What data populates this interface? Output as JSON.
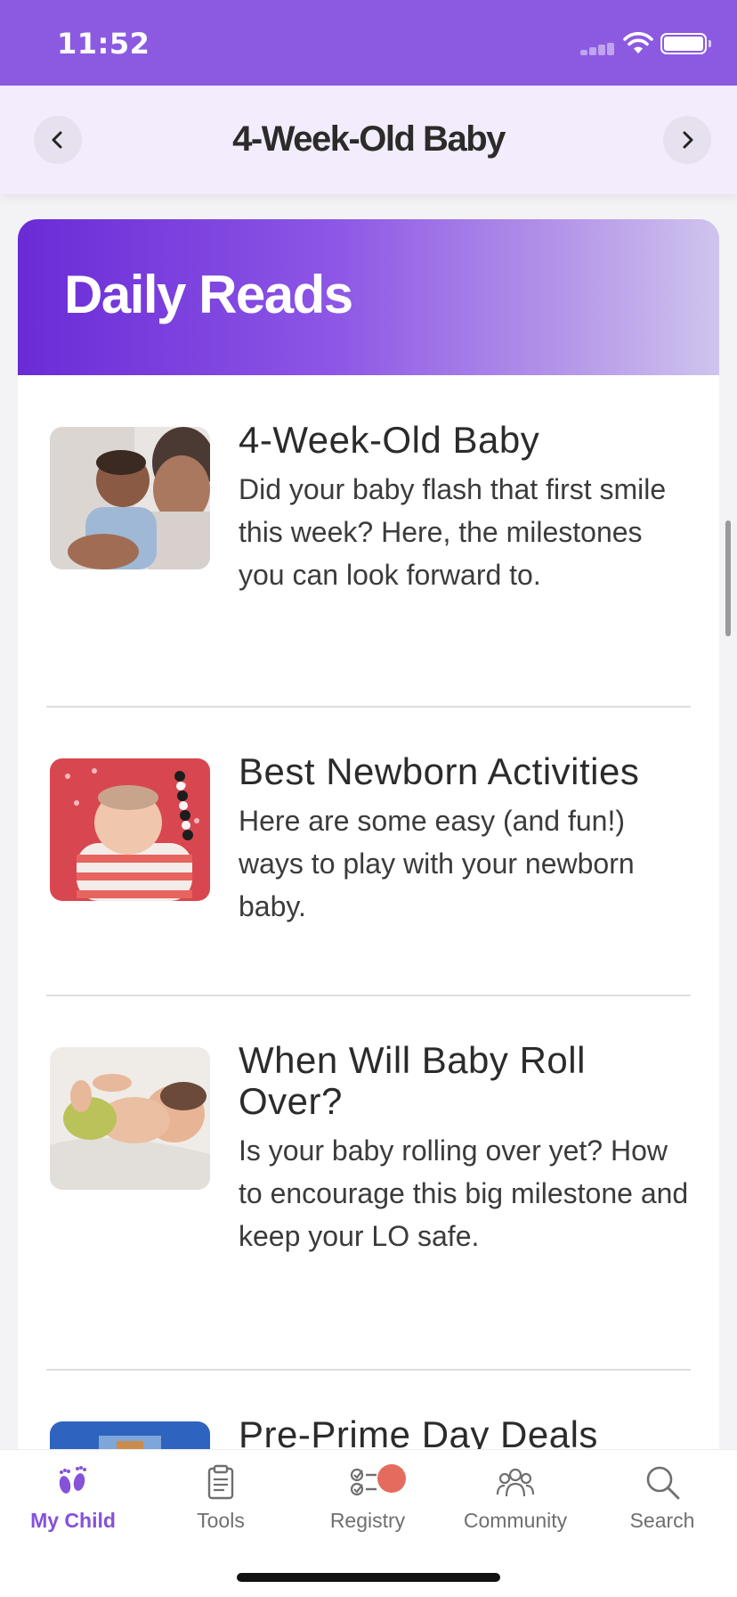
{
  "status_bar": {
    "time": "11:52"
  },
  "nav": {
    "title": "4-Week-Old Baby"
  },
  "card": {
    "header_title": "Daily Reads"
  },
  "articles": [
    {
      "title": "4-Week-Old Baby",
      "description": "Did your baby flash that first smile this week? Here, the milestones you can look forward to.",
      "image": "baby-smiling-photo"
    },
    {
      "title": "Best Newborn Activities",
      "description": "Here are some easy (and fun!) ways to play with your newborn baby.",
      "image": "baby-playing-photo"
    },
    {
      "title": "When Will Baby Roll Over?",
      "description": "Is your baby rolling over yet? How to encourage this big milestone and keep your LO safe.",
      "image": "baby-lying-photo"
    },
    {
      "title": "Pre-Prime Day Deals",
      "description": "",
      "image": "deals-photo"
    }
  ],
  "tabs": [
    {
      "label": "My Child",
      "icon": "baby-feet-icon",
      "active": true
    },
    {
      "label": "Tools",
      "icon": "clipboard-icon",
      "active": false
    },
    {
      "label": "Registry",
      "icon": "checklist-icon",
      "active": false
    },
    {
      "label": "Community",
      "icon": "people-icon",
      "active": false
    },
    {
      "label": "Search",
      "icon": "search-icon",
      "active": false
    }
  ],
  "colors": {
    "accent": "#8c5ae0",
    "active_tab": "#8552d9",
    "badge": "#e56b5f"
  }
}
